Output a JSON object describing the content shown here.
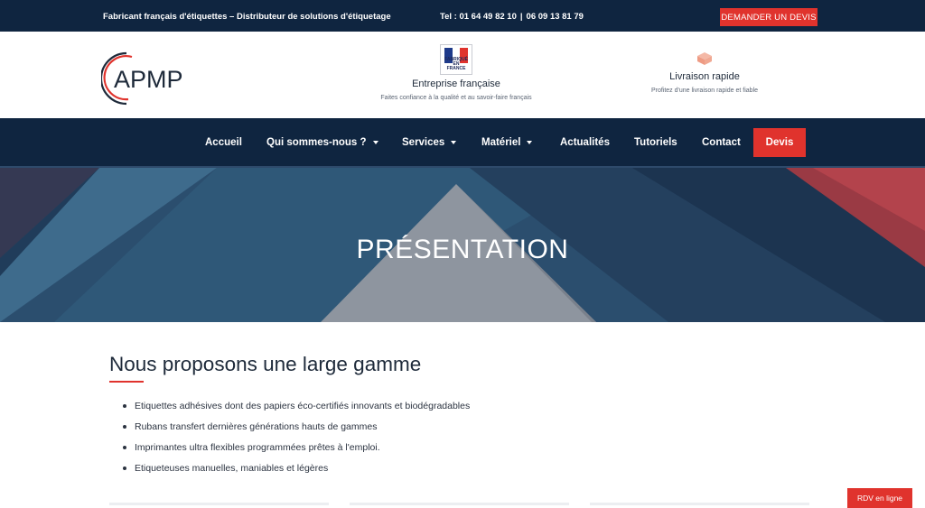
{
  "topbar": {
    "tagline": "Fabricant français d'étiquettes – Distributeur de solutions d'étiquetage",
    "phone_label": "Tel : 01 64 49 82 10",
    "phone_sep": "|",
    "phone_2": "06 09 13 81 79",
    "quote_button": "DEMANDER UN DEVIS"
  },
  "header": {
    "logo_text": "APMP",
    "features": [
      {
        "icon": "fabrique-en-france-badge",
        "badge_text_1": "FABRIQUÉ EN",
        "badge_text_2": "FRANCE",
        "title": "Entreprise française",
        "subtitle": "Faites confiance à la qualité et au savoir-faire français"
      },
      {
        "icon": "box-icon",
        "title": "Livraison rapide",
        "subtitle": "Profitez d'une livraison rapide et fiable"
      }
    ]
  },
  "nav": {
    "items": [
      {
        "label": "Accueil"
      },
      {
        "label": "Qui sommes-nous ?"
      },
      {
        "label": "Services"
      },
      {
        "label": "Matériel"
      },
      {
        "label": "Actualités"
      },
      {
        "label": "Tutoriels"
      },
      {
        "label": "Contact"
      }
    ],
    "devis_button": "Devis"
  },
  "hero": {
    "title": "PRÉSENTATION"
  },
  "content": {
    "title": "Nous proposons une large gamme",
    "bullets": [
      "Etiquettes adhésives dont des papiers éco-certifiés innovants et biodégradables",
      "Rubans transfert dernières générations hauts de gammes",
      "Imprimantes ultra flexibles programmées prêtes à l'emploi.",
      "Etiqueteuses manuelles, maniables et légères"
    ]
  },
  "floating": {
    "rdv_button": "RDV en ligne"
  },
  "colors": {
    "navy": "#0f2540",
    "accent_red": "#e0332d",
    "hero_blue": "#2b4e6e"
  }
}
